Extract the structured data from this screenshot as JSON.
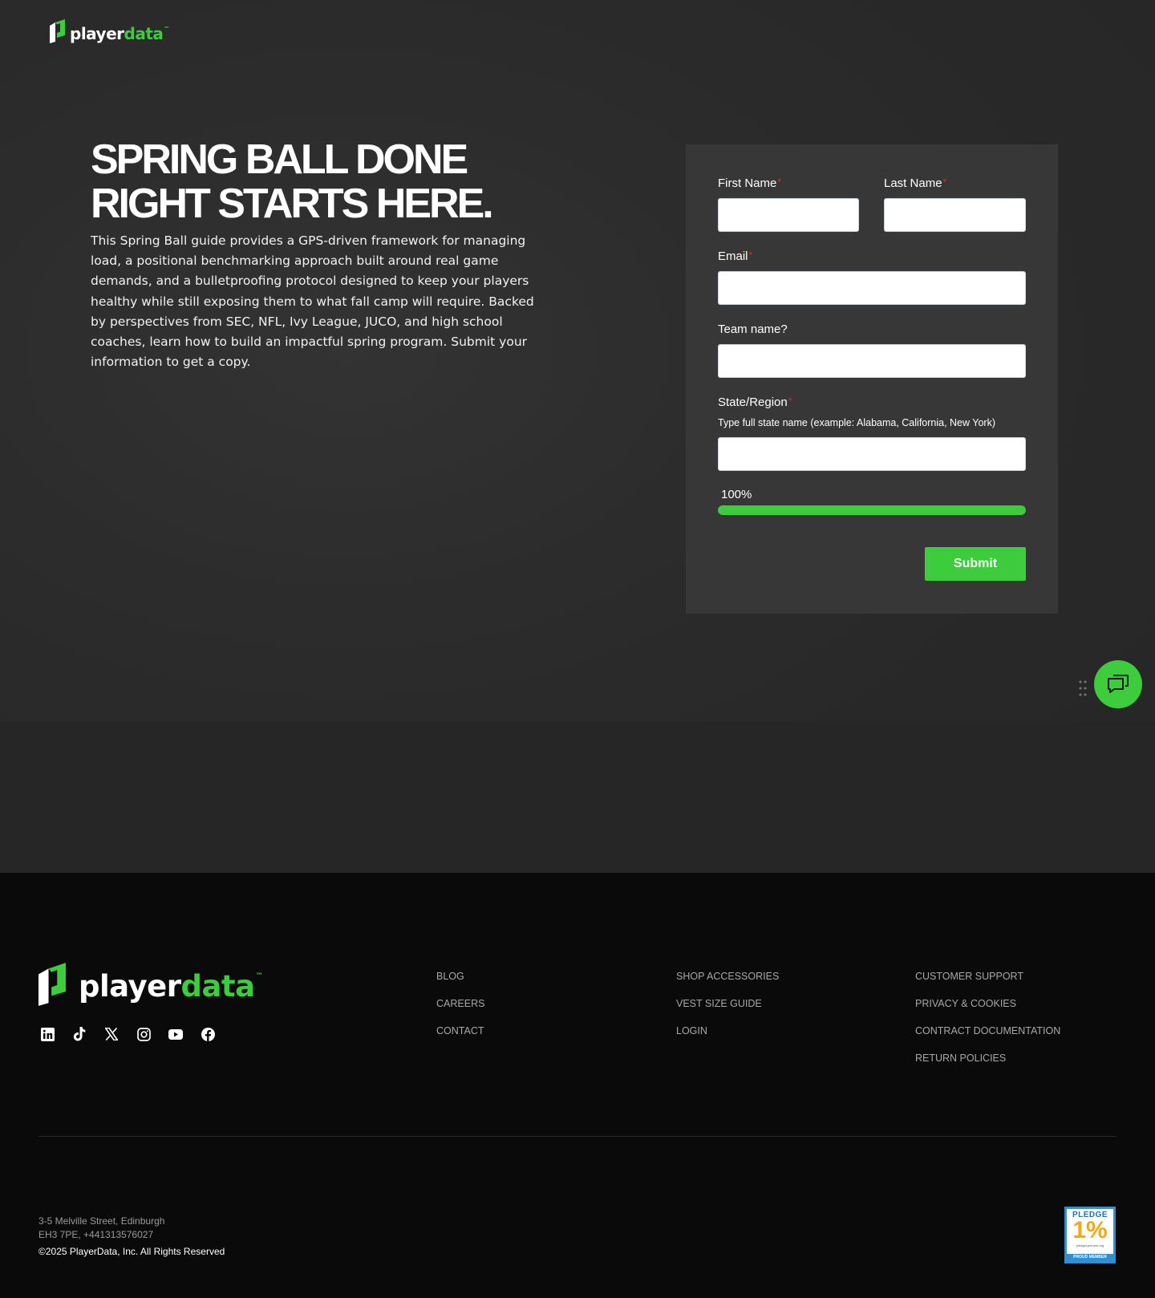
{
  "brand": {
    "name_part1": "player",
    "name_part2": "data",
    "trademark": "™",
    "accent_color": "#3ccc3c"
  },
  "hero": {
    "headline_line1": "SPRING BALL DONE",
    "headline_line2": "RIGHT STARTS HERE.",
    "intro": "This Spring Ball guide provides a GPS-driven framework for managing load, a positional benchmarking approach built around real game demands, and a bulletproofing protocol designed to keep your players healthy while still exposing them to what fall camp will require. Backed by perspectives from SEC, NFL, Ivy League, JUCO, and high school coaches, learn how to build an impactful spring program. Submit your information to get a copy."
  },
  "form": {
    "first_name_label": "First Name",
    "first_name_value": "",
    "last_name_label": "Last Name",
    "last_name_value": "",
    "email_label": "Email",
    "email_value": "",
    "team_label": "Team name?",
    "team_value": "",
    "state_label": "State/Region",
    "state_help": "Type full state name (example: Alabama, California, New York)",
    "state_value": "",
    "required_marker": "*",
    "progress_label": "100%",
    "progress_fraction": 1.0,
    "submit_label": "Submit"
  },
  "chat": {
    "icon": "chat-bubbles-icon",
    "handle_icon": "drag-handle-icon"
  },
  "footer": {
    "socials": [
      "linkedin-icon",
      "tiktok-icon",
      "x-icon",
      "instagram-icon",
      "youtube-icon",
      "facebook-icon"
    ],
    "col1": [
      "BLOG",
      "CAREERS",
      "CONTACT"
    ],
    "col2": [
      "SHOP ACCESSORIES",
      "VEST SIZE GUIDE",
      "LOGIN"
    ],
    "col3": [
      "CUSTOMER SUPPORT",
      "PRIVACY & COOKIES",
      "CONTRACT DOCUMENTATION",
      "RETURN POLICIES"
    ],
    "address_line1": "3-5 Melville Street, Edinburgh",
    "address_line2": "EH3 7PE, +441313576027",
    "copyright": "©2025 PlayerData, Inc. All Rights Reserved",
    "pledge": {
      "top": "PLEDGE",
      "big": "1%",
      "small": "pledge1percent.org",
      "bottom": "PROUD MEMBER"
    }
  }
}
